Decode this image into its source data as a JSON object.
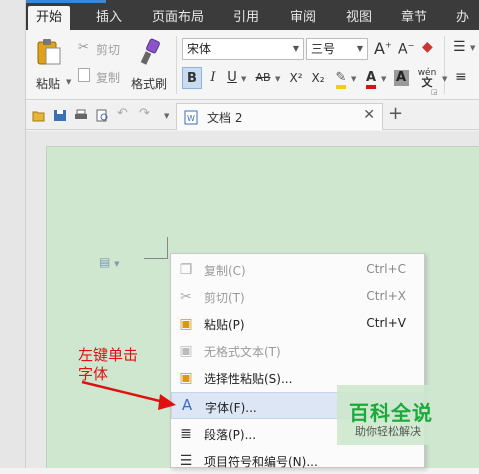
{
  "menu": {
    "tabs": [
      "开始",
      "插入",
      "页面布局",
      "引用",
      "审阅",
      "视图",
      "章节",
      "办公"
    ]
  },
  "ribbon": {
    "paste": "粘贴",
    "cut": "剪切",
    "copy": "复制",
    "format_painter": "格式刷",
    "font_name": "宋体",
    "font_size": "三号",
    "buttons": {
      "bold": "B",
      "italic": "I",
      "underline": "U",
      "strike": "AB",
      "superscript": "X²",
      "subscript": "X₂",
      "phonetic": "wén"
    }
  },
  "document": {
    "tab_title": "文档 2"
  },
  "context_menu": {
    "items": [
      {
        "label": "复制(C)",
        "shortcut": "Ctrl+C",
        "enabled": false,
        "icon": "copy-icon"
      },
      {
        "label": "剪切(T)",
        "shortcut": "Ctrl+X",
        "enabled": false,
        "icon": "scissors-icon"
      },
      {
        "label": "粘贴(P)",
        "shortcut": "Ctrl+V",
        "enabled": true,
        "icon": "paste-icon"
      },
      {
        "label": "无格式文本(T)",
        "shortcut": "",
        "enabled": false,
        "icon": "plain-paste-icon"
      },
      {
        "label": "选择性粘贴(S)...",
        "shortcut": "",
        "enabled": true,
        "icon": "paste-special-icon"
      },
      {
        "label": "字体(F)...",
        "shortcut": "",
        "enabled": true,
        "icon": "font-icon",
        "highlighted": true
      },
      {
        "label": "段落(P)...",
        "shortcut": "",
        "enabled": true,
        "icon": "paragraph-icon"
      },
      {
        "label": "项目符号和编号(N)...",
        "shortcut": "",
        "enabled": true,
        "icon": "bullets-icon"
      }
    ]
  },
  "annotation": {
    "line1": "左键单击",
    "line2": "字体",
    "color": "#e01010"
  },
  "watermark": {
    "title": "百科全说",
    "subtitle": "助你轻松解决"
  },
  "colors": {
    "menubar": "#3b3b3b",
    "page_bg": "#cfe7cf",
    "highlight": "#dce6f5"
  }
}
